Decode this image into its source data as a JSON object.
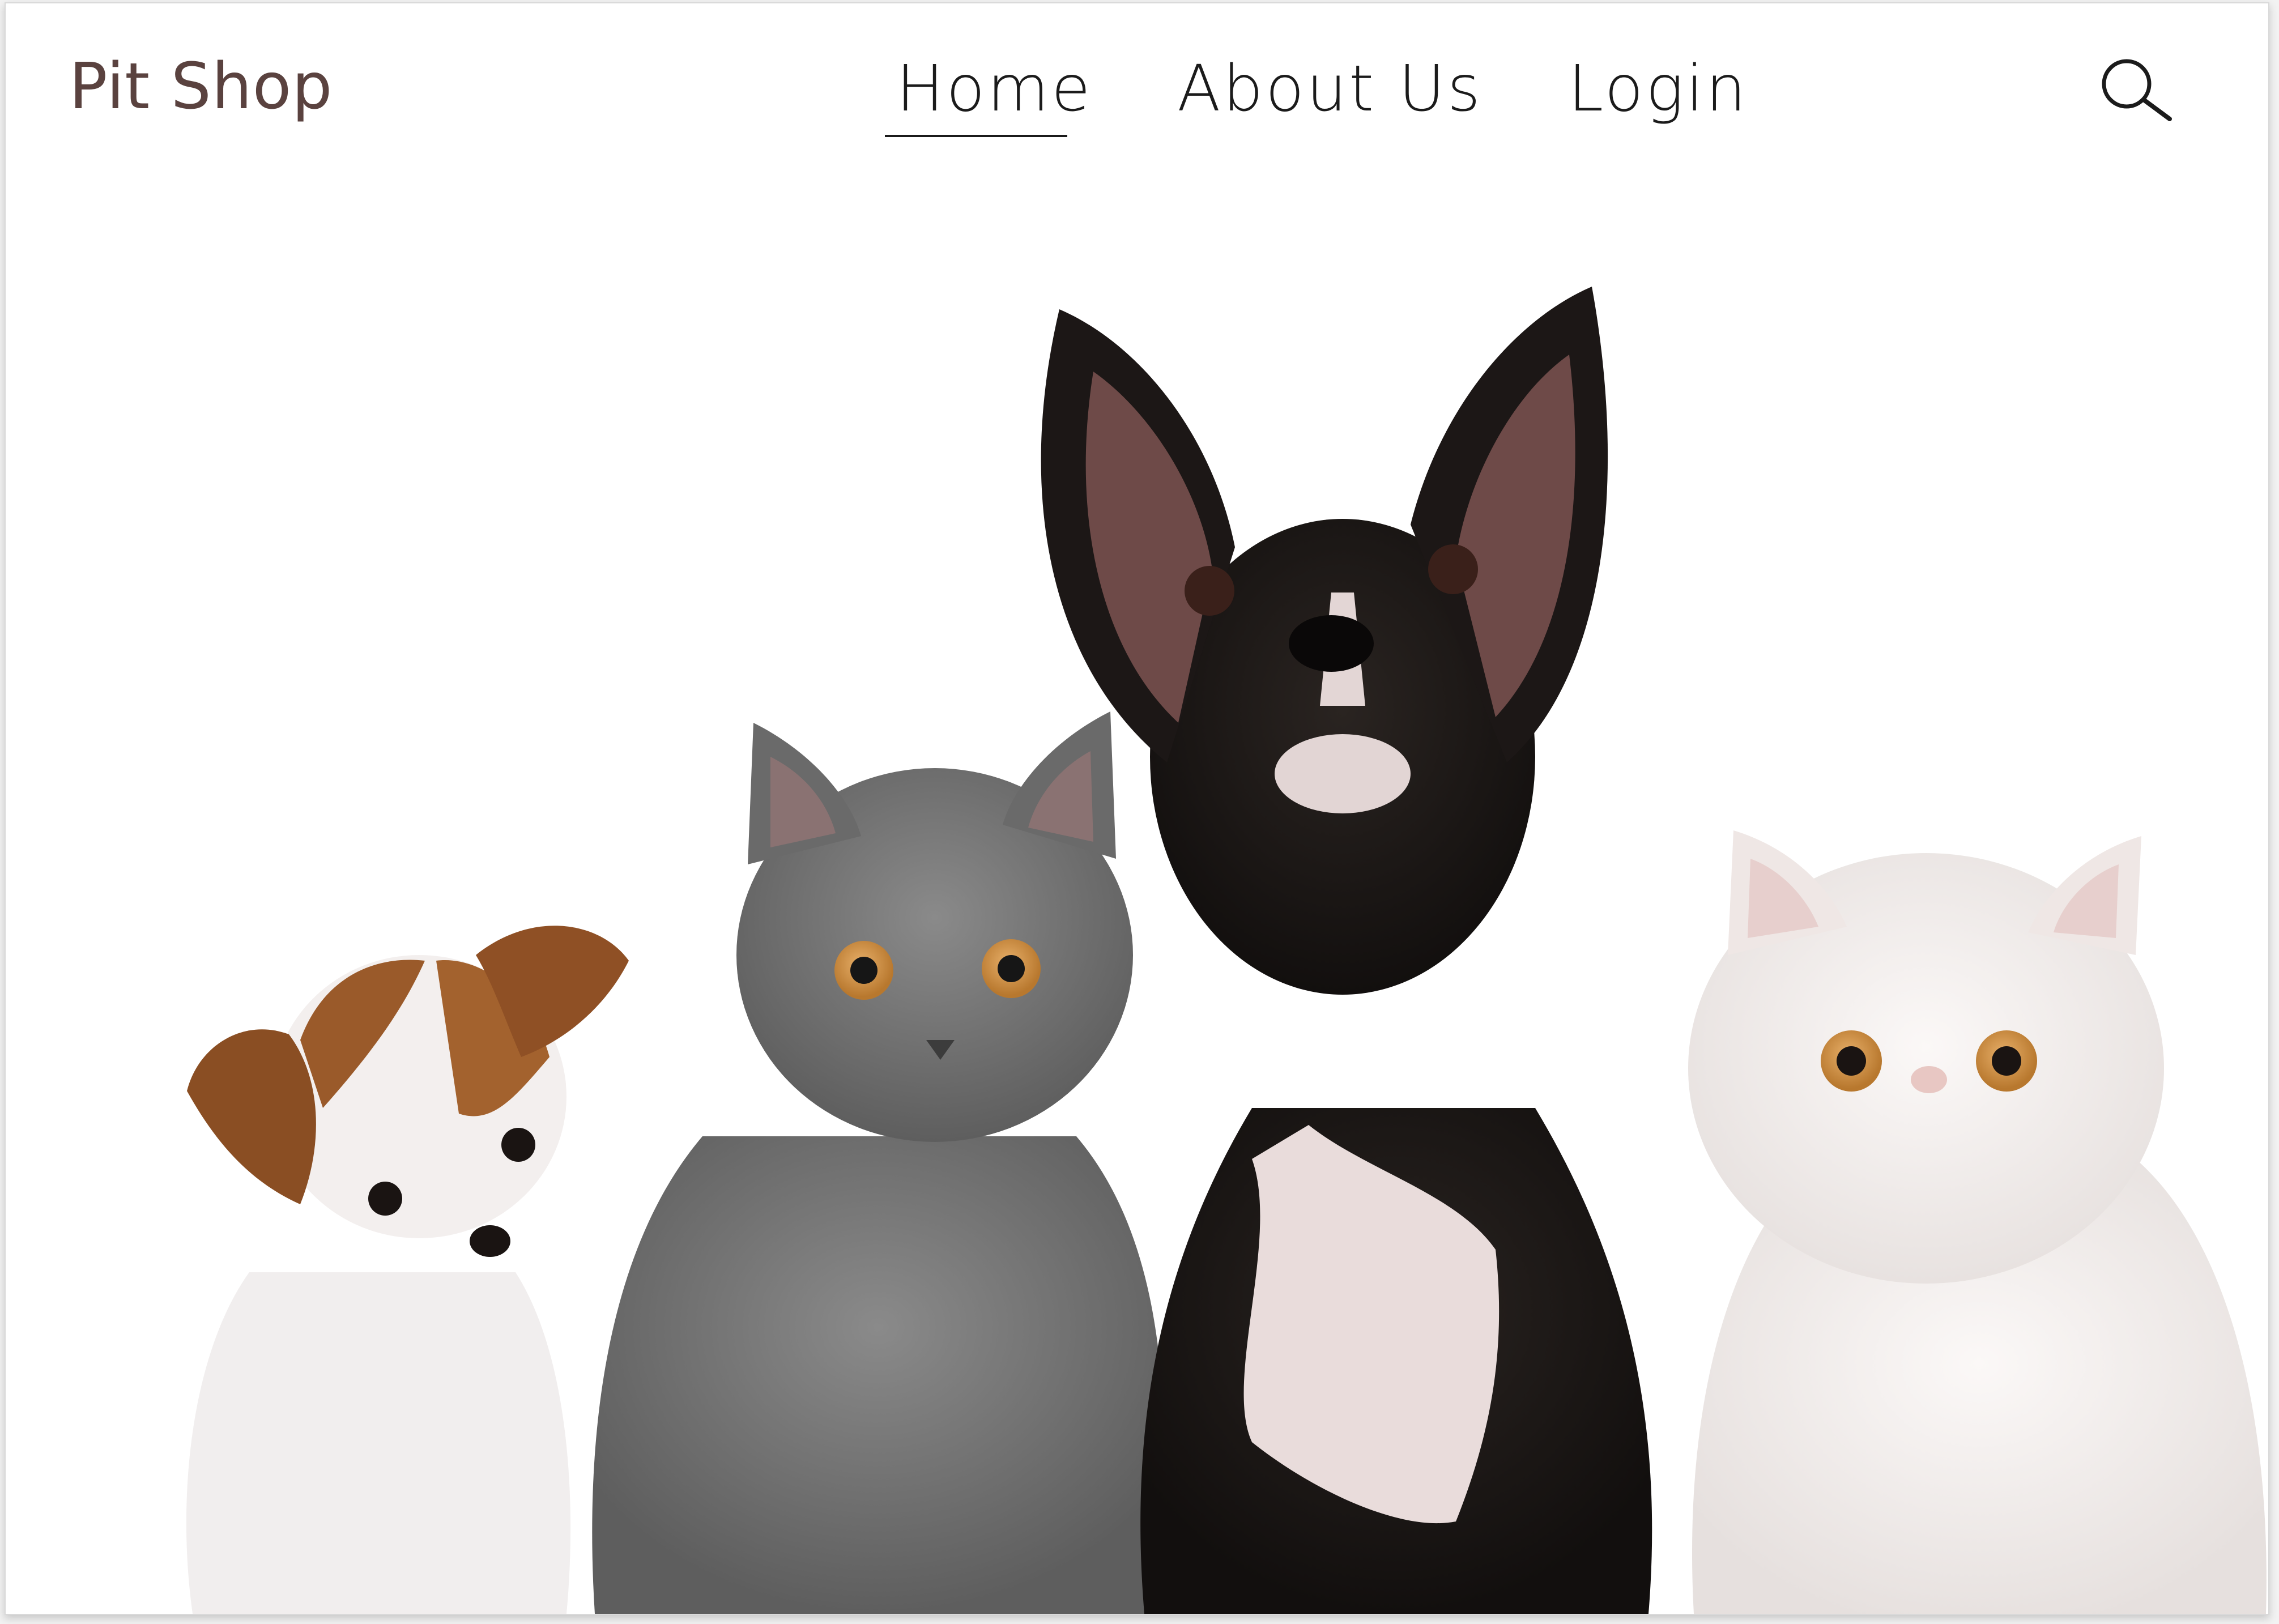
{
  "brand": {
    "name": "Pit Shop",
    "color": "#5a423f"
  },
  "nav": {
    "items": [
      {
        "label": "Home",
        "active": true
      },
      {
        "label": "About Us",
        "active": false
      },
      {
        "label": "Login",
        "active": false
      }
    ]
  },
  "search": {
    "icon": "search-icon"
  },
  "hero": {
    "animals": [
      "chihuahua-puppy",
      "gray-kitten",
      "french-bulldog",
      "white-persian-cat"
    ]
  }
}
